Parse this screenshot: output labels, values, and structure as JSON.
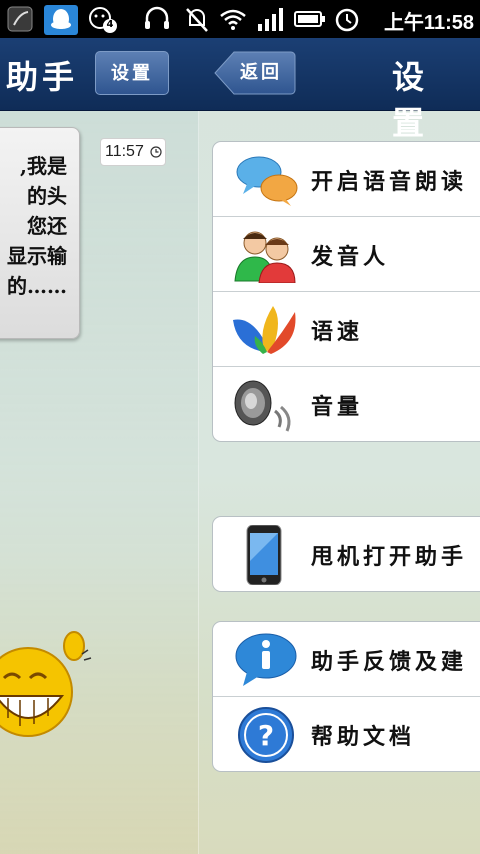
{
  "status_bar": {
    "notification_count": "4",
    "time": "上午11:58",
    "icons": [
      "app-icon",
      "qq-icon",
      "wechat-icon",
      "headset-icon",
      "mute-icon",
      "wifi-icon",
      "signal-icon",
      "battery-icon",
      "alarm-icon"
    ]
  },
  "header": {
    "left_title": "助手",
    "settings_button": "设置",
    "back_button": "返回",
    "right_title": "设置"
  },
  "chat": {
    "message_lines": [
      ",我是",
      "的头",
      "您还",
      "显示输",
      "的……"
    ],
    "timestamp": "11:57"
  },
  "settings": {
    "group1": [
      {
        "icon": "speech-bubbles-icon",
        "label": "开启语音朗读"
      },
      {
        "icon": "people-icon",
        "label": "发音人"
      },
      {
        "icon": "butterfly-icon",
        "label": "语速"
      },
      {
        "icon": "speaker-icon",
        "label": "音量"
      }
    ],
    "group2": [
      {
        "icon": "phone-icon",
        "label": "甩机打开助手"
      }
    ],
    "group3": [
      {
        "icon": "info-icon",
        "label": "助手反馈及建"
      },
      {
        "icon": "help-icon",
        "label": "帮助文档"
      }
    ]
  },
  "colors": {
    "header_bg": "#163a6c",
    "status_bar_bg": "#000000",
    "accent_blue": "#2e6fd0"
  }
}
